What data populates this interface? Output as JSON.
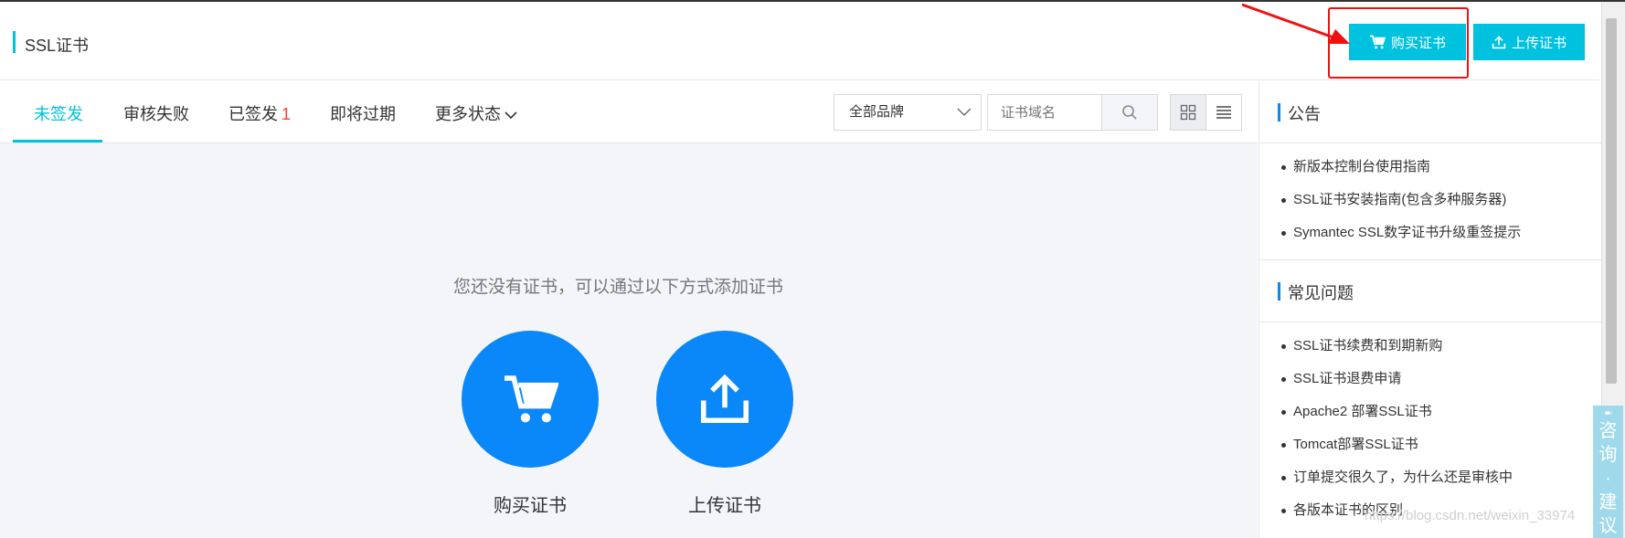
{
  "header": {
    "title": "SSL证书",
    "buy_button": "购买证书",
    "upload_button": "上传证书"
  },
  "tabs": [
    {
      "label": "未签发",
      "active": true
    },
    {
      "label": "审核失败"
    },
    {
      "label": "已签发",
      "count": "1"
    },
    {
      "label": "即将过期"
    },
    {
      "label": "更多状态"
    }
  ],
  "filters": {
    "brand_select": "全部品牌",
    "search_placeholder": "证书域名"
  },
  "empty": {
    "message": "您还没有证书，可以通过以下方式添加证书",
    "buy_label": "购买证书",
    "upload_label": "上传证书"
  },
  "sidebar": {
    "notice_title": "公告",
    "notice_items": [
      "新版本控制台使用指南",
      "SSL证书安装指南(包含多种服务器)",
      "Symantec SSL数字证书升级重签提示"
    ],
    "faq_title": "常见问题",
    "faq_items": [
      "SSL证书续费和到期新购",
      "SSL证书退费申请",
      "Apache2 部署SSL证书",
      "Tomcat部署SSL证书",
      "订单提交很久了，为什么还是审核中",
      "各版本证书的区别"
    ]
  },
  "consult": {
    "chars": [
      "咨",
      "询",
      "·",
      "建",
      "议"
    ]
  },
  "watermark": "https://blog.csdn.net/weixin_33974",
  "colors": {
    "accent": "#00c1de",
    "primary_blue": "#0a87f8",
    "annotation_red": "#f01010",
    "count_red": "#ff3b30"
  },
  "icons": [
    "cart-icon",
    "upload-icon",
    "search-icon",
    "grid-view-icon",
    "list-view-icon",
    "chevron-down-icon",
    "chat-icon"
  ]
}
